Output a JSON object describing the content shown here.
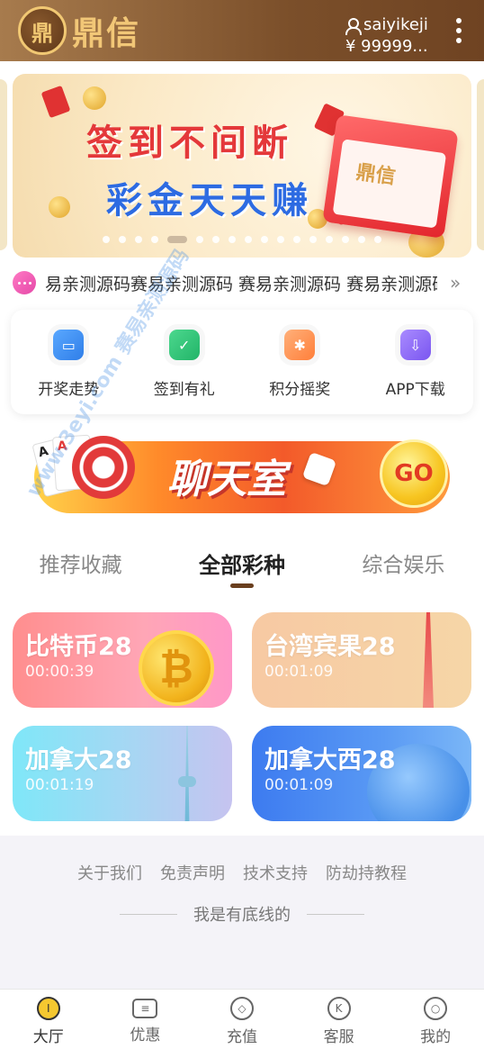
{
  "header": {
    "logo_mark": "鼎",
    "logo_text": "鼎信",
    "username": "saiyikeji",
    "balance": "¥ 99999..."
  },
  "banner": {
    "line1": "签到不间断",
    "line2": "彩金天天赚",
    "calendar_label": "鼎信",
    "slide_count": 17,
    "active_slide": 4
  },
  "notice": {
    "text": "易亲测源码赛易亲测源码 赛易亲测源码 赛易亲测源码 赛易亲测源码"
  },
  "quick_menu": [
    {
      "label": "开奖走势",
      "icon": "chart-monitor-icon",
      "color": "#3d8cf0"
    },
    {
      "label": "签到有礼",
      "icon": "calendar-check-icon",
      "color": "#2fc07a"
    },
    {
      "label": "积分摇奖",
      "icon": "wheel-icon",
      "color": "#ff8a3d"
    },
    {
      "label": "APP下载",
      "icon": "download-icon",
      "color": "#8a63f5"
    }
  ],
  "chat_banner": {
    "title": "聊天室",
    "go_label": "GO"
  },
  "tabs": [
    {
      "label": "推荐收藏",
      "active": false
    },
    {
      "label": "全部彩种",
      "active": true
    },
    {
      "label": "综合娱乐",
      "active": false
    }
  ],
  "watermark": "www.3eyi.com 赛易亲测源码",
  "games": [
    {
      "name": "比特币28",
      "time": "00:00:39"
    },
    {
      "name": "台湾宾果28",
      "time": "00:01:09"
    },
    {
      "name": "加拿大28",
      "time": "00:01:19"
    },
    {
      "name": "加拿大西28",
      "time": "00:01:09"
    }
  ],
  "footer": {
    "links": [
      "关于我们",
      "免责声明",
      "技术支持",
      "防劫持教程"
    ],
    "bottom_line": "我是有底线的"
  },
  "bottom_nav": [
    {
      "label": "大厅",
      "icon": "lobby-icon",
      "active": true
    },
    {
      "label": "优惠",
      "icon": "ticket-icon",
      "active": false
    },
    {
      "label": "充值",
      "icon": "recharge-icon",
      "active": false
    },
    {
      "label": "客服",
      "icon": "support-icon",
      "active": false
    },
    {
      "label": "我的",
      "icon": "profile-icon",
      "active": false
    }
  ],
  "colors": {
    "header_start": "#a77b4d",
    "header_end": "#6f4322",
    "gold": "#f2c777",
    "tab_indicator": "#6a3f1f"
  }
}
